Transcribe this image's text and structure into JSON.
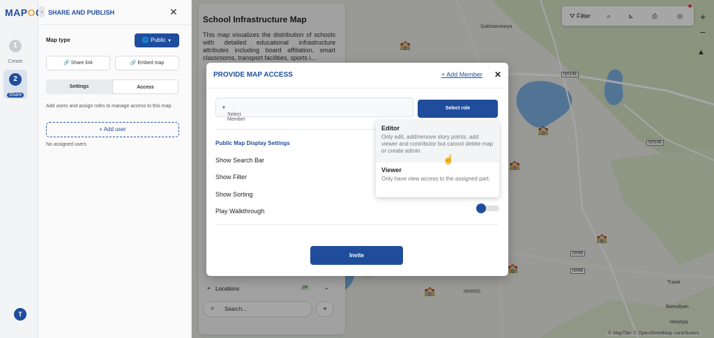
{
  "rail": {
    "logo_left": "MAP",
    "logo_right": "O",
    "logo_end": "G",
    "steps": [
      {
        "num": "1",
        "label": "Create"
      },
      {
        "num": "2",
        "label": "Share"
      }
    ],
    "avatar_initial": "T"
  },
  "panel": {
    "collapse_glyph": "›",
    "title": "SHARE AND PUBLISH",
    "close": "✕",
    "map_type_label": "Map type",
    "map_type_value": "Public",
    "share_link": "Share link",
    "embed_map": "Embed map",
    "tabs": [
      "Settings",
      "Access"
    ],
    "active_tab": "Access",
    "access_desc": "Add users and assign roles to manage access to this map.",
    "add_user": "+ Add user",
    "no_users": "No assigned users"
  },
  "map": {
    "places": [
      "Sukhisevineya",
      "Trawli",
      "Bamuliyan",
      "Hinotiya",
      "MISROD"
    ],
    "road_labels": [
      "NH146",
      "NH146",
      "NH46",
      "NH46"
    ],
    "toolbar": {
      "filter": "Filter"
    },
    "attribution": "© MapTiler © OpenStreetMap contributors",
    "zoom_in": "+",
    "zoom_out": "−"
  },
  "story": {
    "title": "School Infrastructure Map",
    "description": "This map visualizes the distribution of schools with detailed educational infrastructure attributes including board affiliation, smart classrooms, transport facilities, sports i...",
    "locations_label": "Locations",
    "locations_count": "24",
    "search_placeholder": "Search..."
  },
  "modal": {
    "title": "PROVIDE MAP ACCESS",
    "add_member": "+ Add Member",
    "close": "✕",
    "select_member": "Select Member",
    "select_role": "Select role",
    "settings_title": "Public Map Display Settings",
    "settings": [
      "Show Search Bar",
      "Show Filter",
      "Show Sorting",
      "Play Walkthrough"
    ],
    "invite": "Invite"
  },
  "role_menu": {
    "options": [
      {
        "name": "Editor",
        "desc": "Only edit, add/remove story points, add viewer and contributor but cannot delete map or create admin."
      },
      {
        "name": "Viewer",
        "desc": "Only have view access to the assigned part."
      }
    ]
  },
  "colors": {
    "primary": "#1f4d9c",
    "school_marker": "#b02ab0",
    "school_marker_alt": "#4caf50"
  }
}
